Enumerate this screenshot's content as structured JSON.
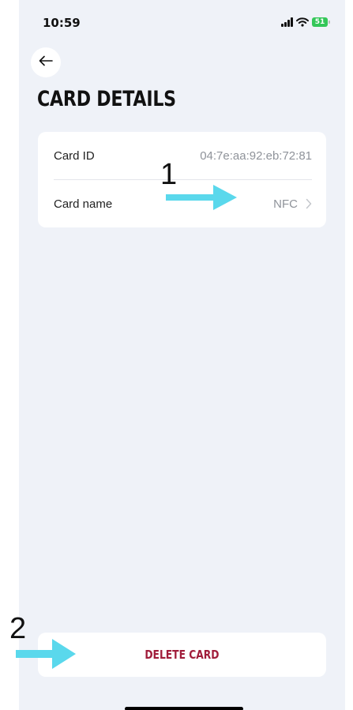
{
  "status_bar": {
    "time": "10:59",
    "battery": "51"
  },
  "header": {
    "title": "CARD DETAILS"
  },
  "details": {
    "rows": [
      {
        "label": "Card ID",
        "value": "04:7e:aa:92:eb:72:81"
      },
      {
        "label": "Card name",
        "value": "NFC"
      }
    ]
  },
  "actions": {
    "delete_label": "DELETE CARD"
  },
  "annotations": {
    "one": "1",
    "two": "2"
  },
  "colors": {
    "background": "#eff2f8",
    "card": "#ffffff",
    "delete_text": "#a01c3a",
    "annotation_arrow": "#5ad8ec",
    "battery": "#34c759"
  },
  "icons": {
    "back": "arrow-left-icon",
    "chevron": "chevron-right-icon",
    "signal": "signal-icon",
    "wifi": "wifi-icon",
    "battery": "battery-icon"
  }
}
